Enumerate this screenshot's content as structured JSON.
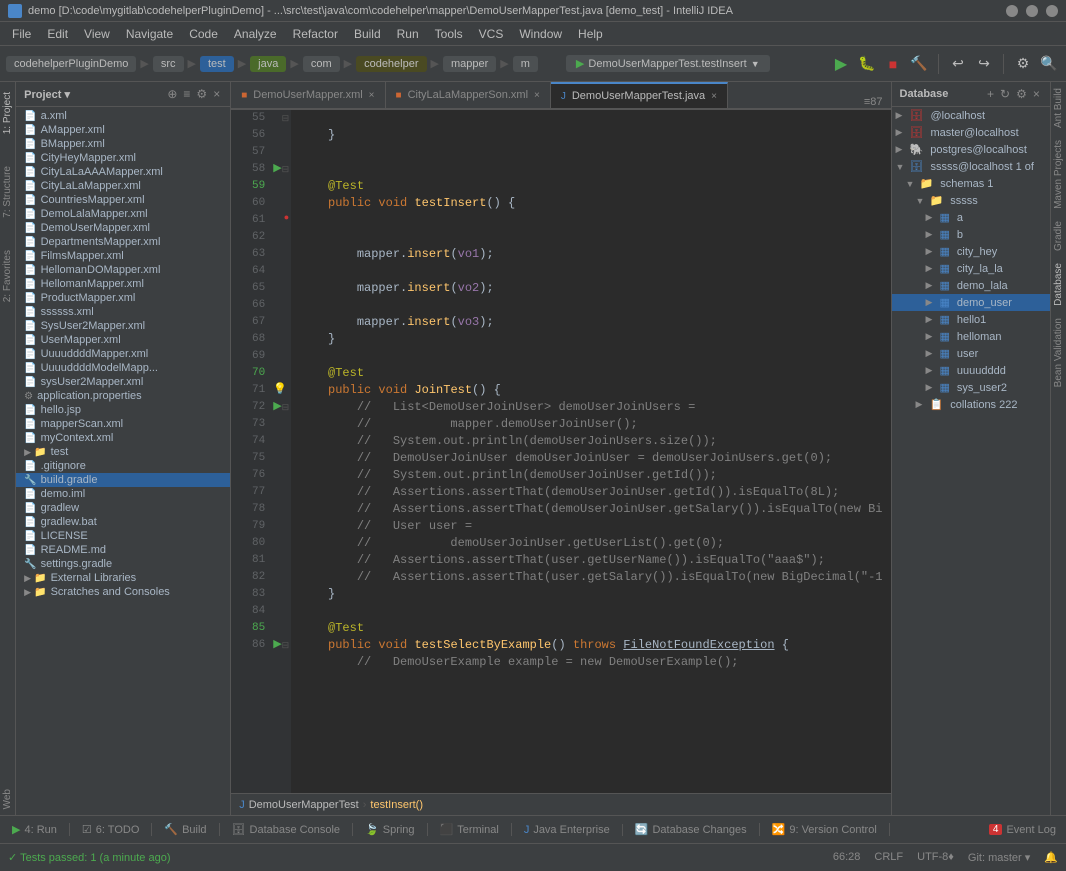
{
  "titleBar": {
    "text": "demo [D:\\code\\mygitlab\\codehelperPluginDemo] - ...\\src\\test\\java\\com\\codehelper\\mapper\\DemoUserMapperTest.java [demo_test] - IntelliJ IDEA"
  },
  "menuBar": {
    "items": [
      "File",
      "Edit",
      "View",
      "Navigate",
      "Code",
      "Analyze",
      "Refactor",
      "Build",
      "Run",
      "Tools",
      "VCS",
      "Window",
      "Help"
    ]
  },
  "toolbar": {
    "breadcrumbs": [
      "codehelperPluginDemo",
      "src",
      "test",
      "java",
      "com",
      "codehelper",
      "mapper",
      "m"
    ],
    "runConfig": "DemoUserMapperTest.testInsert"
  },
  "projectPanel": {
    "title": "Project",
    "files": [
      {
        "name": "a.xml",
        "type": "xml",
        "indent": 0
      },
      {
        "name": "AMapper.xml",
        "type": "xml",
        "indent": 0
      },
      {
        "name": "BMapper.xml",
        "type": "xml",
        "indent": 0
      },
      {
        "name": "CityHeyMapper.xml",
        "type": "xml",
        "indent": 0
      },
      {
        "name": "CityLaLaAAAMapper.xml",
        "type": "xml",
        "indent": 0
      },
      {
        "name": "CityLaLaMapper.xml",
        "type": "xml",
        "indent": 0
      },
      {
        "name": "CountriesMapper.xml",
        "type": "xml",
        "indent": 0
      },
      {
        "name": "DemoLalaMapper.xml",
        "type": "xml",
        "indent": 0
      },
      {
        "name": "DemoUserMapper.xml",
        "type": "xml",
        "indent": 0
      },
      {
        "name": "DepartmentsMapper.xml",
        "type": "xml",
        "indent": 0
      },
      {
        "name": "FilmsMapper.xml",
        "type": "xml",
        "indent": 0
      },
      {
        "name": "HellomanDOMapper.xml",
        "type": "xml",
        "indent": 0
      },
      {
        "name": "HellomanMapper.xml",
        "type": "xml",
        "indent": 0
      },
      {
        "name": "ProductMapper.xml",
        "type": "xml",
        "indent": 0
      },
      {
        "name": "ssssss.xml",
        "type": "xml",
        "indent": 0
      },
      {
        "name": "SysUser2Mapper.xml",
        "type": "xml",
        "indent": 0
      },
      {
        "name": "UserMapper.xml",
        "type": "xml",
        "indent": 0
      },
      {
        "name": "UuuuddddMapper.xml",
        "type": "xml",
        "indent": 0
      },
      {
        "name": "UuuuddddModelMapper.xml",
        "type": "xml",
        "indent": 0
      },
      {
        "name": "sysUser2Mapper.xml",
        "type": "xml",
        "indent": 0
      },
      {
        "name": "application.properties",
        "type": "prop",
        "indent": 0
      },
      {
        "name": "hello.jsp",
        "type": "jsp",
        "indent": 0
      },
      {
        "name": "mapperScan.xml",
        "type": "xml",
        "indent": 0
      },
      {
        "name": "myContext.xml",
        "type": "xml",
        "indent": 0
      },
      {
        "name": "test",
        "type": "folder",
        "indent": 0
      },
      {
        "name": ".gitignore",
        "type": "file",
        "indent": 0
      },
      {
        "name": "build.gradle",
        "type": "gradle",
        "indent": 0,
        "selected": true
      },
      {
        "name": "demo.iml",
        "type": "iml",
        "indent": 0
      },
      {
        "name": "gradlew",
        "type": "file",
        "indent": 0
      },
      {
        "name": "gradlew.bat",
        "type": "file",
        "indent": 0
      },
      {
        "name": "LICENSE",
        "type": "file",
        "indent": 0
      },
      {
        "name": "README.md",
        "type": "file",
        "indent": 0
      },
      {
        "name": "settings.gradle",
        "type": "gradle",
        "indent": 0
      },
      {
        "name": "External Libraries",
        "type": "folder",
        "indent": 0
      },
      {
        "name": "Scratches and Consoles",
        "type": "folder",
        "indent": 0
      }
    ]
  },
  "editorTabs": [
    {
      "name": "DemoUserMapper.xml",
      "type": "xml",
      "active": false
    },
    {
      "name": "CityLaLaMapperSon.xml",
      "type": "xml",
      "active": false
    },
    {
      "name": "DemoUserMapperTest.java",
      "type": "java",
      "active": true
    }
  ],
  "tabCount": "≡87",
  "codeLines": [
    {
      "num": 55,
      "content": "    }"
    },
    {
      "num": 56,
      "content": ""
    },
    {
      "num": 57,
      "content": ""
    },
    {
      "num": 58,
      "content": "    @Test"
    },
    {
      "num": 59,
      "content": "    public void testInsert() {"
    },
    {
      "num": 60,
      "content": ""
    },
    {
      "num": 61,
      "content": ""
    },
    {
      "num": 62,
      "content": "        mapper.insert(vo1);"
    },
    {
      "num": 63,
      "content": ""
    },
    {
      "num": 64,
      "content": "        mapper.insert(vo2);"
    },
    {
      "num": 65,
      "content": ""
    },
    {
      "num": 66,
      "content": "        mapper.insert(vo3);"
    },
    {
      "num": 67,
      "content": "    }"
    },
    {
      "num": 68,
      "content": ""
    },
    {
      "num": 69,
      "content": "    @Test"
    },
    {
      "num": 70,
      "content": "    public void JoinTest() {"
    },
    {
      "num": 71,
      "content": "        //   List<DemoUserJoinUser> demoUserJoinUsers ="
    },
    {
      "num": 72,
      "content": "        //           mapper.demoUserJoinUser();"
    },
    {
      "num": 73,
      "content": "        //   System.out.println(demoUserJoinUsers.size());"
    },
    {
      "num": 74,
      "content": "        //   DemoUserJoinUser demoUserJoinUser = demoUserJoinUsers.get(0);"
    },
    {
      "num": 75,
      "content": "        //   System.out.println(demoUserJoinUser.getId());"
    },
    {
      "num": 76,
      "content": "        //   Assertions.assertThat(demoUserJoinUser.getId()).isEqualTo(8L);"
    },
    {
      "num": 77,
      "content": "        //   Assertions.assertThat(demoUserJoinUser.getSalary()).isEqualTo(new Bi"
    },
    {
      "num": 78,
      "content": "        //   User user ="
    },
    {
      "num": 79,
      "content": "        //           demoUserJoinUser.getUserList().get(0);"
    },
    {
      "num": 80,
      "content": "        //   Assertions.assertThat(user.getUserName()).isEqualTo(\"aaa$\");"
    },
    {
      "num": 81,
      "content": "        //   Assertions.assertThat(user.getSalary()).isEqualTo(new BigDecimal(\"-1"
    },
    {
      "num": 82,
      "content": "    }"
    },
    {
      "num": 83,
      "content": ""
    },
    {
      "num": 84,
      "content": "    @Test"
    },
    {
      "num": 85,
      "content": "    public void testSelectByExample() throws FileNotFoundException {"
    },
    {
      "num": 86,
      "content": "        //   DemoUserExample example = new DemoUserExample();"
    }
  ],
  "editorBreadcrumb": {
    "items": [
      "DemoUserMapperTest",
      "testInsert()"
    ]
  },
  "database": {
    "title": "Database",
    "items": [
      {
        "name": "@localhost",
        "type": "server",
        "indent": 0,
        "expanded": false
      },
      {
        "name": "master@localhost",
        "type": "server",
        "indent": 0,
        "expanded": false
      },
      {
        "name": "postgres@localhost",
        "type": "server",
        "indent": 0,
        "expanded": false
      },
      {
        "name": "sssss@localhost  1 of",
        "type": "server",
        "indent": 0,
        "expanded": true
      },
      {
        "name": "schemas  1",
        "type": "folder",
        "indent": 1,
        "expanded": true
      },
      {
        "name": "sssss",
        "type": "schema",
        "indent": 2,
        "expanded": true
      },
      {
        "name": "a",
        "type": "table",
        "indent": 3,
        "expanded": false
      },
      {
        "name": "b",
        "type": "table",
        "indent": 3,
        "expanded": false
      },
      {
        "name": "city_hey",
        "type": "table",
        "indent": 3,
        "expanded": false
      },
      {
        "name": "city_la_la",
        "type": "table",
        "indent": 3,
        "expanded": false
      },
      {
        "name": "demo_lala",
        "type": "table",
        "indent": 3,
        "expanded": false
      },
      {
        "name": "demo_user",
        "type": "table",
        "indent": 3,
        "expanded": false,
        "selected": true
      },
      {
        "name": "hello1",
        "type": "table",
        "indent": 3,
        "expanded": false
      },
      {
        "name": "helloman",
        "type": "table",
        "indent": 3,
        "expanded": false
      },
      {
        "name": "user",
        "type": "table",
        "indent": 3,
        "expanded": false
      },
      {
        "name": "uuuudddd",
        "type": "table",
        "indent": 3,
        "expanded": false
      },
      {
        "name": "sys_user2",
        "type": "table",
        "indent": 3,
        "expanded": false
      },
      {
        "name": "collations  222",
        "type": "collation",
        "indent": 2,
        "expanded": false
      }
    ]
  },
  "bottomTabs": [
    {
      "label": "4: Run",
      "icon": "run"
    },
    {
      "label": "6: TODO",
      "icon": "todo"
    },
    {
      "label": "Build",
      "icon": "build"
    },
    {
      "label": "Database Console",
      "icon": "db"
    },
    {
      "label": "Spring",
      "icon": "spring"
    },
    {
      "label": "Terminal",
      "icon": "terminal"
    },
    {
      "label": "Java Enterprise",
      "icon": "java"
    },
    {
      "label": "Database Changes",
      "icon": "db"
    },
    {
      "label": "9: Version Control",
      "icon": "vc"
    },
    {
      "label": "Event Log",
      "icon": "log",
      "badge": "4"
    }
  ],
  "statusBar": {
    "message": "Tests passed: 1 (a minute ago)",
    "position": "66:28",
    "lineEnding": "CRLF",
    "encoding": "UTF-8",
    "gitBranch": "Git: master"
  },
  "rightSideTabs": [
    "Ant Build",
    "Maven Projects",
    "Gradle",
    "Database",
    "Bean Validation"
  ]
}
